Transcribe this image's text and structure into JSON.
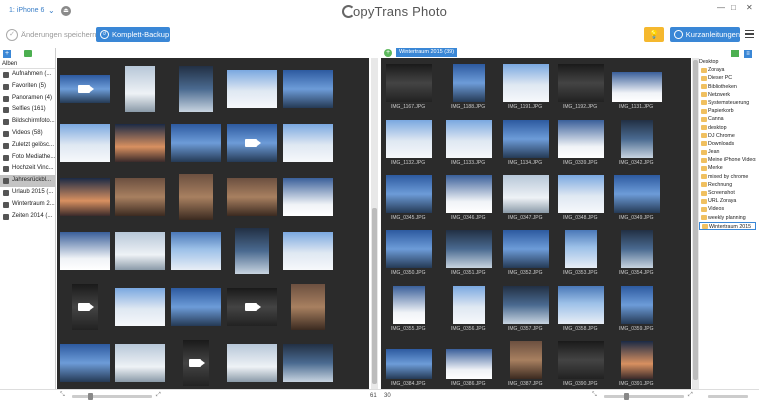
{
  "header": {
    "device": "1: iPhone 6",
    "app_title": "opyTrans Photo",
    "window_controls": [
      "—",
      "□",
      "✕"
    ]
  },
  "toolbar": {
    "save_label": "Änderungen speichern",
    "backup_label": "Komplett-Backup",
    "guides_label": "Kurzanleitungen"
  },
  "sidebar": {
    "heading": "Alben",
    "items": [
      {
        "label": "Aufnahmen (..."
      },
      {
        "label": "Favoriten (5)"
      },
      {
        "label": "Panoramen (4)"
      },
      {
        "label": "Selfies (161)"
      },
      {
        "label": "Bildschirmfoto..."
      },
      {
        "label": "Videos (58)"
      },
      {
        "label": "Zuletzt gelösc..."
      },
      {
        "label": "Foto Mediathe..."
      },
      {
        "label": "Hochzeit Vinc..."
      },
      {
        "label": "Jahresrückbl..."
      },
      {
        "label": "Urlaub 2015 (..."
      },
      {
        "label": "Wintertraum 2..."
      },
      {
        "label": "Zeiten 2014 (..."
      }
    ]
  },
  "right_pane": {
    "album_title": "Wintertraum 2015 (39)",
    "captions": [
      "IMG_1167.JPG",
      "IMG_1188.JPG",
      "IMG_1191.JPG",
      "IMG_1192.JPG",
      "IMG_1131.JPG",
      "IMG_1132.JPG",
      "IMG_1133.JPG",
      "IMG_1134.JPG",
      "IMG_0339.JPG",
      "IMG_0342.JPG",
      "IMG_0345.JPG",
      "IMG_0346.JPG",
      "IMG_0347.JPG",
      "IMG_0348.JPG",
      "IMG_0349.JPG",
      "IMG_0350.JPG",
      "IMG_0351.JPG",
      "IMG_0352.JPG",
      "IMG_0353.JPG",
      "IMG_0354.JPG",
      "IMG_0355.JPG",
      "IMG_0356.JPG",
      "IMG_0357.JPG",
      "IMG_0358.JPG",
      "IMG_0359.JPG",
      "IMG_0384.JPG",
      "IMG_0386.JPG",
      "IMG_0387.JPG",
      "IMG_0390.JPG",
      "IMG_0391.JPG"
    ]
  },
  "tree": {
    "items": [
      {
        "label": "Desktop",
        "root": true
      },
      {
        "label": "Zoraya"
      },
      {
        "label": "Dieser PC"
      },
      {
        "label": "Bibliotheken"
      },
      {
        "label": "Netzwerk"
      },
      {
        "label": "Systemsteuerung"
      },
      {
        "label": "Papierkorb"
      },
      {
        "label": "Canna"
      },
      {
        "label": "desktop"
      },
      {
        "label": "DJ Chrome"
      },
      {
        "label": "Downloads"
      },
      {
        "label": "Jean"
      },
      {
        "label": "Meine iPhone Videos"
      },
      {
        "label": "Merke"
      },
      {
        "label": "mixed by chrome"
      },
      {
        "label": "Rechnung"
      },
      {
        "label": "Screenshot"
      },
      {
        "label": "URL Zoraya"
      },
      {
        "label": "Videos"
      },
      {
        "label": "weekly planning"
      },
      {
        "label": "Wintertraum 2015"
      }
    ]
  },
  "footer": {
    "left_count": "61",
    "right_count": "30"
  }
}
